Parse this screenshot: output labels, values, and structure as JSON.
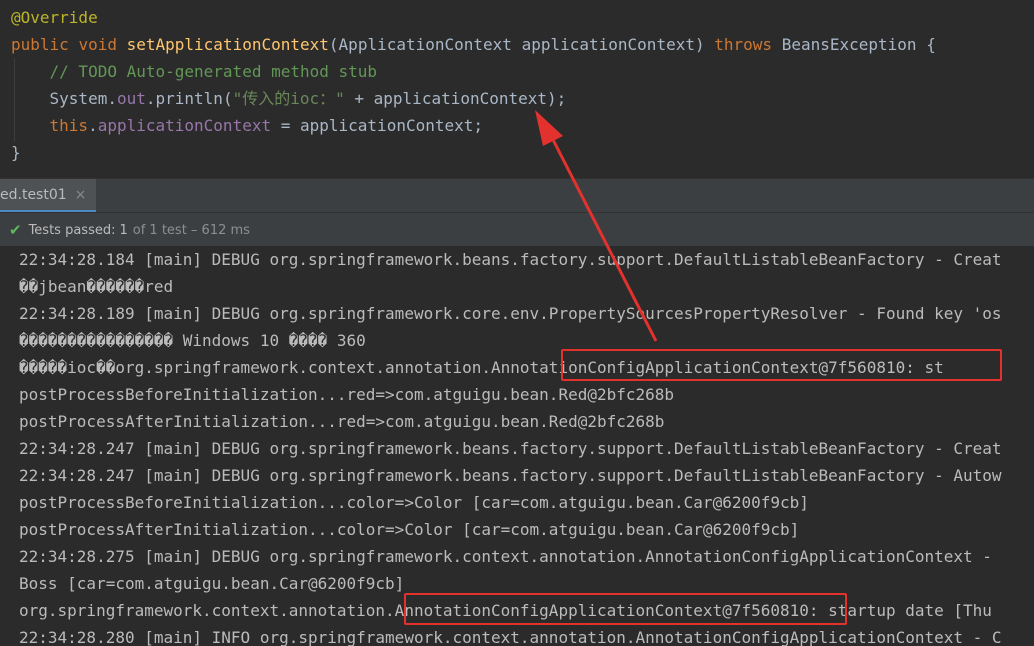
{
  "editor": {
    "line1": {
      "annotation": "@Override"
    },
    "line2": {
      "kw_public": "public",
      "kw_void": "void",
      "method": "setApplicationContext",
      "open": "(",
      "param_type": "ApplicationContext",
      "param_name": "applicationContext",
      "close": ")",
      "kw_throws": "throws",
      "exception": "BeansException",
      "brace": "{"
    },
    "line3": {
      "comment": "// TODO Auto-generated method stub"
    },
    "line4": {
      "system": "System.",
      "out": "out",
      "println": ".println(",
      "string": "\"传入的ioc：\"",
      "rest": " + applicationContext);"
    },
    "line5": {
      "kw_this": "this",
      "dot": ".",
      "field": "applicationContext",
      "rest": " = applicationContext;"
    },
    "line6": {
      "brace": "}"
    }
  },
  "tab": {
    "label": "ed.test01",
    "close": "×"
  },
  "status": {
    "label": "Tests passed:",
    "count": "1",
    "detail": "of 1 test – 612 ms"
  },
  "console": [
    "22:34:28.184 [main] DEBUG org.springframework.beans.factory.support.DefaultListableBeanFactory - Creat",
    "��jbean������red",
    "22:34:28.189 [main] DEBUG org.springframework.core.env.PropertySourcesPropertyResolver - Found key 'os",
    "���������������� Windows 10 ���� 360",
    "�����ioc��org.springframework.context.annotation.AnnotationConfigApplicationContext@7f560810: st",
    "postProcessBeforeInitialization...red=>com.atguigu.bean.Red@2bfc268b",
    "postProcessAfterInitialization...red=>com.atguigu.bean.Red@2bfc268b",
    "22:34:28.247 [main] DEBUG org.springframework.beans.factory.support.DefaultListableBeanFactory - Creat",
    "22:34:28.247 [main] DEBUG org.springframework.beans.factory.support.DefaultListableBeanFactory - Autow",
    "postProcessBeforeInitialization...color=>Color [car=com.atguigu.bean.Car@6200f9cb]",
    "postProcessAfterInitialization...color=>Color [car=com.atguigu.bean.Car@6200f9cb]",
    "22:34:28.275 [main] DEBUG org.springframework.context.annotation.AnnotationConfigApplicationContext - ",
    "Boss [car=com.atguigu.bean.Car@6200f9cb]",
    "org.springframework.context.annotation.AnnotationConfigApplicationContext@7f560810: startup date [Thu",
    "22:34:28.280 [main] INFO org.springframework.context.annotation.AnnotationConfigApplicationContext - C"
  ],
  "colors": {
    "highlight": "#e3322e",
    "passed": "#5fb860",
    "keyword": "#cc7832",
    "method": "#ffc66d",
    "comment": "#629755"
  }
}
